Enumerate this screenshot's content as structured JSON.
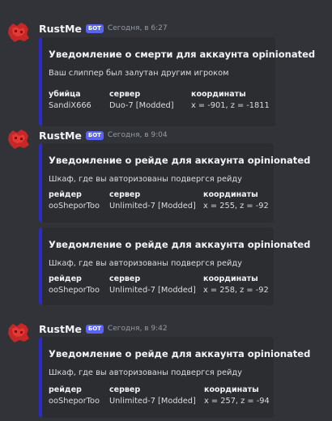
{
  "messages": [
    {
      "author": "RustMe",
      "badge": "БОТ",
      "time": "Сегодня, в 6:27",
      "embeds": [
        {
          "title": "Уведомление о смерти для аккаунта opinionated",
          "description": "Ваш слиппер был залутан другим игроком",
          "fields": [
            {
              "name": "убийца",
              "value": "SandiX666"
            },
            {
              "name": "сервер",
              "value": "Duo-7 [Modded]"
            },
            {
              "name": "координаты",
              "value": "x = -901, z = -1811"
            }
          ]
        }
      ]
    },
    {
      "author": "RustMe",
      "badge": "БОТ",
      "time": "Сегодня, в 9:04",
      "embeds": [
        {
          "title": "Уведомление о рейде для аккаунта opinionated",
          "description": "Шкаф, где вы авторизованы подвергся рейду",
          "fields": [
            {
              "name": "рейдер",
              "value": "ooSheporToo"
            },
            {
              "name": "сервер",
              "value": "Unlimited-7 [Modded]"
            },
            {
              "name": "координаты",
              "value": "x = 255, z = -92"
            }
          ]
        },
        {
          "title": "Уведомление о рейде для аккаунта opinionated",
          "description": "Шкаф, где вы авторизованы подвергся рейду",
          "fields": [
            {
              "name": "рейдер",
              "value": "ooSheporToo"
            },
            {
              "name": "сервер",
              "value": "Unlimited-7 [Modded]"
            },
            {
              "name": "координаты",
              "value": "x = 258, z = -92"
            }
          ]
        }
      ]
    },
    {
      "author": "RustMe",
      "badge": "БОТ",
      "time": "Сегодня, в 9:42",
      "embeds": [
        {
          "title": "Уведомление о рейде для аккаунта opinionated",
          "description": "Шкаф, где вы авторизованы подвергся рейду",
          "fields": [
            {
              "name": "рейдер",
              "value": "ooSheporToo"
            },
            {
              "name": "сервер",
              "value": "Unlimited-7 [Modded]"
            },
            {
              "name": "координаты",
              "value": "x = 257, z = -94"
            }
          ]
        }
      ]
    }
  ],
  "colors": {
    "background": "#313338",
    "embed_background": "#2b2d31",
    "embed_accent": "#2b2bc9",
    "bot_badge": "#5865f2",
    "avatar": "#d32f2f"
  }
}
